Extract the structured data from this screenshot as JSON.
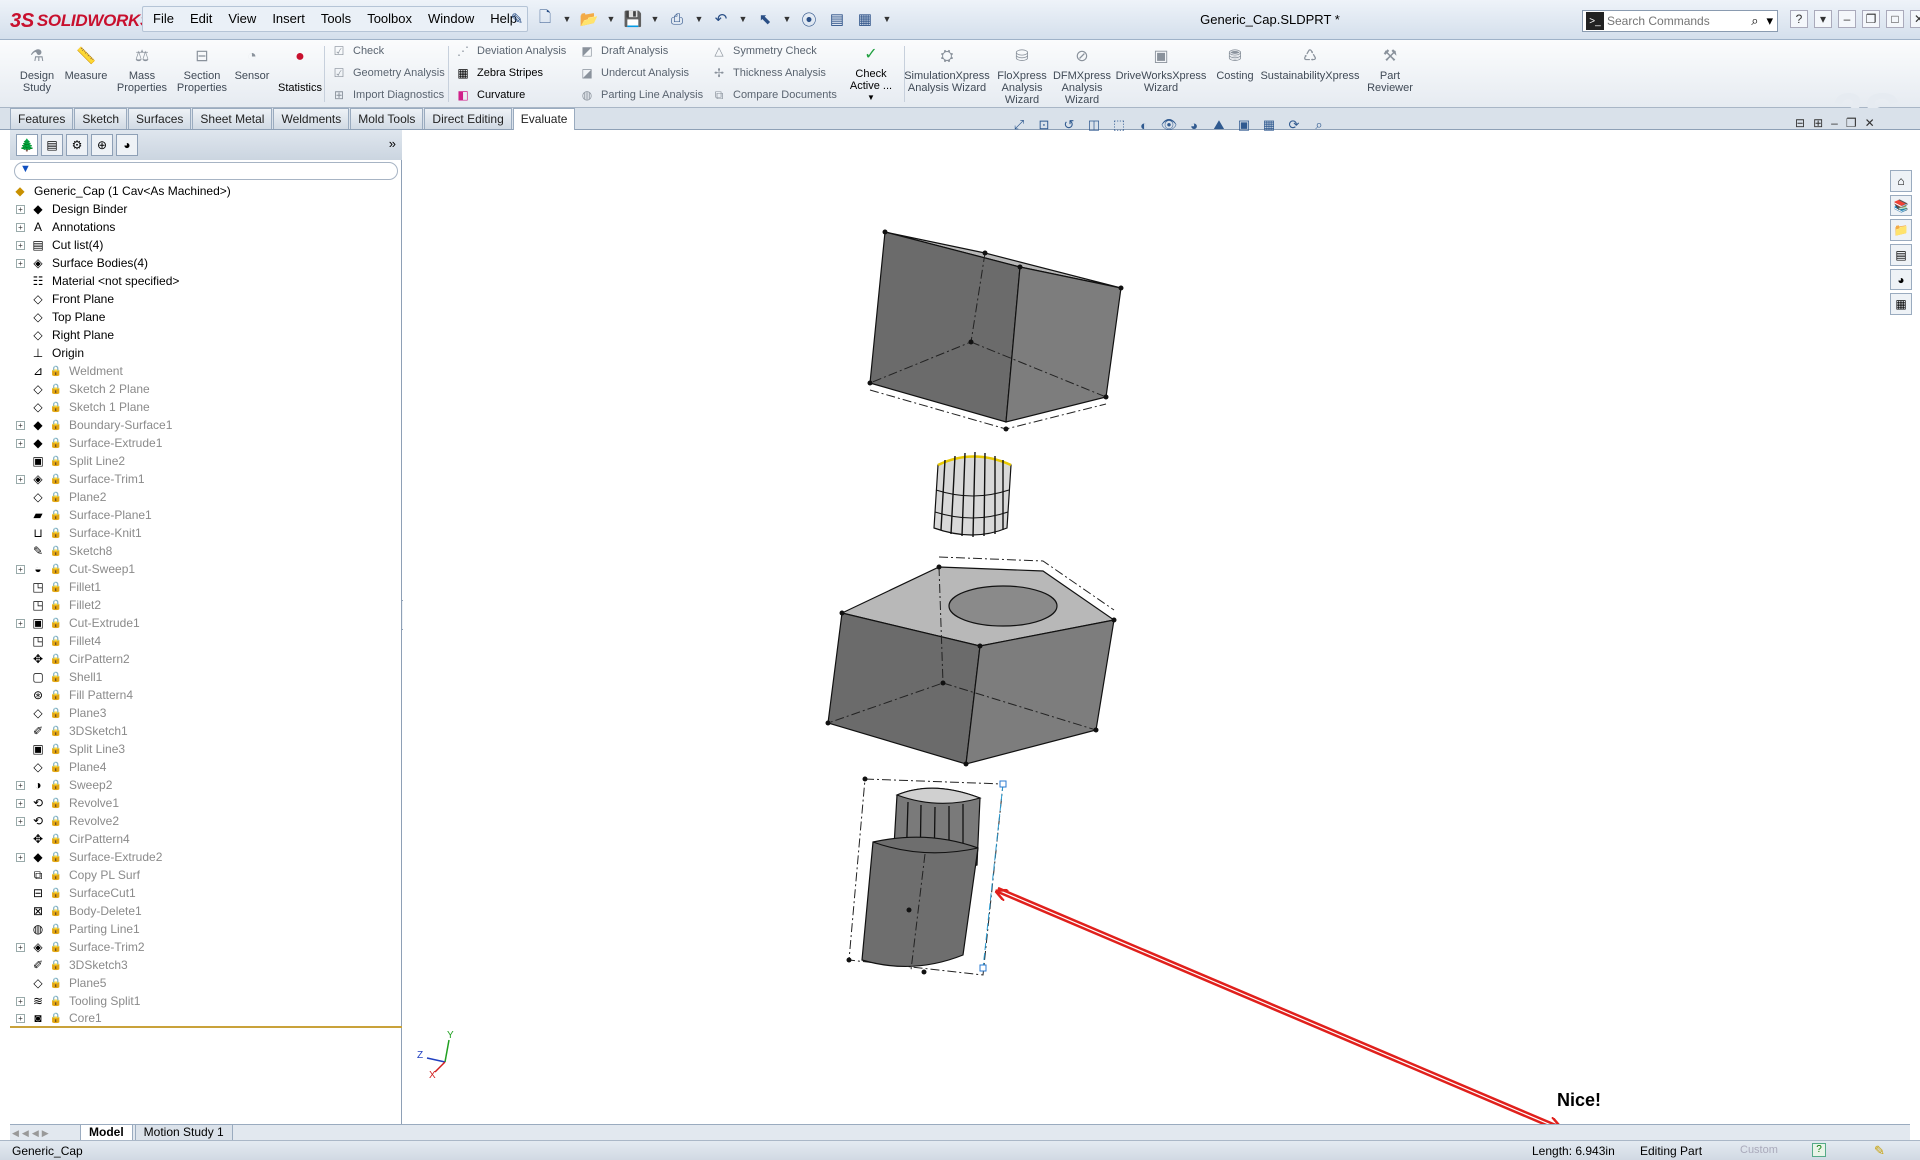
{
  "app": {
    "brand": "SOLIDWORKS",
    "brand_prefix": "3S",
    "document_title": "Generic_Cap.SLDPRT *"
  },
  "menu": [
    "File",
    "Edit",
    "View",
    "Insert",
    "Tools",
    "Toolbox",
    "Window",
    "Help"
  ],
  "search": {
    "placeholder": "Search Commands"
  },
  "command_manager": {
    "large_buttons": [
      {
        "name": "design-study",
        "label": "Design Study",
        "icon": "design-study-icon"
      },
      {
        "name": "measure",
        "label": "Measure",
        "icon": "measure-icon"
      },
      {
        "name": "mass-properties",
        "label": "Mass Properties",
        "icon": "mass-properties-icon"
      },
      {
        "name": "section-properties",
        "label": "Section Properties",
        "icon": "section-properties-icon"
      },
      {
        "name": "sensor",
        "label": "Sensor",
        "icon": "sensor-icon"
      },
      {
        "name": "statistics",
        "label": "Statistics",
        "icon": "statistics-icon"
      }
    ],
    "group1": [
      "Check",
      "Geometry Analysis",
      "Import Diagnostics"
    ],
    "group2": [
      "Deviation Analysis",
      "Zebra Stripes",
      "Curvature"
    ],
    "group3": [
      "Draft Analysis",
      "Undercut Analysis",
      "Parting Line Analysis"
    ],
    "group4": [
      "Symmetry Check",
      "Thickness Analysis",
      "Compare Documents"
    ],
    "check_active": "Check Active ...",
    "wizards": [
      "SimulationXpress Analysis Wizard",
      "FloXpress Analysis Wizard",
      "DFMXpress Analysis Wizard",
      "DriveWorksXpress Wizard",
      "Costing",
      "SustainabilityXpress",
      "Part Reviewer"
    ]
  },
  "tabs": [
    "Features",
    "Sketch",
    "Surfaces",
    "Sheet Metal",
    "Weldments",
    "Mold Tools",
    "Direct Editing",
    "Evaluate"
  ],
  "active_tab": "Evaluate",
  "feature_tree": {
    "root": "Generic_Cap  (1 Cav<As Machined>)",
    "items": [
      {
        "label": "Design Binder",
        "expand": true,
        "locked": false,
        "icon": "design-binder-icon"
      },
      {
        "label": "Annotations",
        "expand": true,
        "locked": false,
        "icon": "annotations-icon"
      },
      {
        "label": "Cut list(4)",
        "expand": true,
        "locked": false,
        "icon": "cut-list-icon"
      },
      {
        "label": "Surface Bodies(4)",
        "expand": true,
        "locked": false,
        "icon": "surface-bodies-icon"
      },
      {
        "label": "Material <not specified>",
        "expand": false,
        "locked": false,
        "icon": "material-icon"
      },
      {
        "label": "Front Plane",
        "expand": false,
        "locked": false,
        "icon": "plane-icon"
      },
      {
        "label": "Top Plane",
        "expand": false,
        "locked": false,
        "icon": "plane-icon"
      },
      {
        "label": "Right Plane",
        "expand": false,
        "locked": false,
        "icon": "plane-icon"
      },
      {
        "label": "Origin",
        "expand": false,
        "locked": false,
        "icon": "origin-icon"
      },
      {
        "label": "Weldment",
        "expand": false,
        "locked": true,
        "icon": "weldment-icon"
      },
      {
        "label": "Sketch 2 Plane",
        "expand": false,
        "locked": true,
        "icon": "plane-icon"
      },
      {
        "label": "Sketch 1 Plane",
        "expand": false,
        "locked": true,
        "icon": "plane-icon"
      },
      {
        "label": "Boundary-Surface1",
        "expand": true,
        "locked": true,
        "icon": "boundary-surface-icon"
      },
      {
        "label": "Surface-Extrude1",
        "expand": true,
        "locked": true,
        "icon": "surface-extrude-icon"
      },
      {
        "label": "Split Line2",
        "expand": false,
        "locked": true,
        "icon": "split-line-icon"
      },
      {
        "label": "Surface-Trim1",
        "expand": true,
        "locked": true,
        "icon": "surface-trim-icon"
      },
      {
        "label": "Plane2",
        "expand": false,
        "locked": true,
        "icon": "plane-icon"
      },
      {
        "label": "Surface-Plane1",
        "expand": false,
        "locked": true,
        "icon": "surface-plane-icon"
      },
      {
        "label": "Surface-Knit1",
        "expand": false,
        "locked": true,
        "icon": "surface-knit-icon"
      },
      {
        "label": "Sketch8",
        "expand": false,
        "locked": true,
        "icon": "sketch-icon"
      },
      {
        "label": "Cut-Sweep1",
        "expand": true,
        "locked": true,
        "icon": "cut-sweep-icon"
      },
      {
        "label": "Fillet1",
        "expand": false,
        "locked": true,
        "icon": "fillet-icon"
      },
      {
        "label": "Fillet2",
        "expand": false,
        "locked": true,
        "icon": "fillet-icon"
      },
      {
        "label": "Cut-Extrude1",
        "expand": true,
        "locked": true,
        "icon": "cut-extrude-icon"
      },
      {
        "label": "Fillet4",
        "expand": false,
        "locked": true,
        "icon": "fillet-icon"
      },
      {
        "label": "CirPattern2",
        "expand": false,
        "locked": true,
        "icon": "circular-pattern-icon"
      },
      {
        "label": "Shell1",
        "expand": false,
        "locked": true,
        "icon": "shell-icon"
      },
      {
        "label": "Fill Pattern4",
        "expand": false,
        "locked": true,
        "icon": "fill-pattern-icon"
      },
      {
        "label": "Plane3",
        "expand": false,
        "locked": true,
        "icon": "plane-icon"
      },
      {
        "label": "3DSketch1",
        "expand": false,
        "locked": true,
        "icon": "3d-sketch-icon"
      },
      {
        "label": "Split Line3",
        "expand": false,
        "locked": true,
        "icon": "split-line-icon"
      },
      {
        "label": "Plane4",
        "expand": false,
        "locked": true,
        "icon": "plane-icon"
      },
      {
        "label": "Sweep2",
        "expand": true,
        "locked": true,
        "icon": "sweep-icon"
      },
      {
        "label": "Revolve1",
        "expand": true,
        "locked": true,
        "icon": "revolve-icon"
      },
      {
        "label": "Revolve2",
        "expand": true,
        "locked": true,
        "icon": "revolve-icon"
      },
      {
        "label": "CirPattern4",
        "expand": false,
        "locked": true,
        "icon": "circular-pattern-icon"
      },
      {
        "label": "Surface-Extrude2",
        "expand": true,
        "locked": true,
        "icon": "surface-extrude-icon"
      },
      {
        "label": "Copy PL Surf",
        "expand": false,
        "locked": true,
        "icon": "copy-surface-icon"
      },
      {
        "label": "SurfaceCut1",
        "expand": false,
        "locked": true,
        "icon": "surface-cut-icon"
      },
      {
        "label": "Body-Delete1",
        "expand": false,
        "locked": true,
        "icon": "body-delete-icon"
      },
      {
        "label": "Parting Line1",
        "expand": false,
        "locked": true,
        "icon": "parting-line-icon"
      },
      {
        "label": "Surface-Trim2",
        "expand": true,
        "locked": true,
        "icon": "surface-trim-icon"
      },
      {
        "label": "3DSketch3",
        "expand": false,
        "locked": true,
        "icon": "3d-sketch-icon"
      },
      {
        "label": "Plane5",
        "expand": false,
        "locked": true,
        "icon": "plane-icon"
      },
      {
        "label": "Tooling Split1",
        "expand": true,
        "locked": true,
        "icon": "tooling-split-icon"
      },
      {
        "label": "Core1",
        "expand": true,
        "locked": true,
        "icon": "core-icon"
      }
    ]
  },
  "bottom_tabs": [
    "Model",
    "Motion Study 1"
  ],
  "annotation": {
    "text": "Nice!"
  },
  "status": {
    "document": "Generic_Cap",
    "length": "Length: 6.943in",
    "mode": "Editing Part",
    "units": "Custom"
  }
}
